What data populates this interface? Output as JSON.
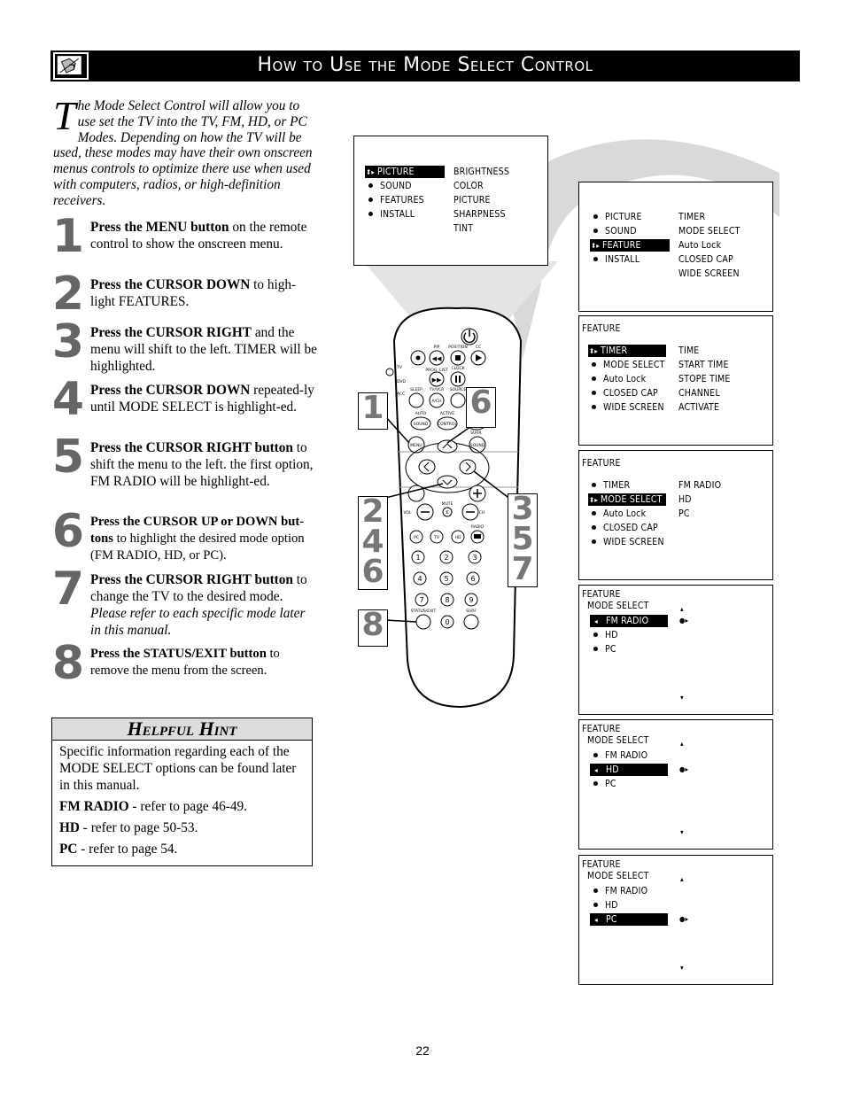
{
  "header": {
    "title": "How to Use the Mode Select Control",
    "icon": "remote-hand-icon"
  },
  "intro": {
    "dropcap": "T",
    "text": "he Mode Select Control will allow you to use set the TV into the TV, FM, HD, or PC Modes. Depending on how the TV will be used, these modes may have their own onscreen menus controls to optimize there use when used with computers, radios, or high-definition receivers."
  },
  "steps": [
    {
      "number": "1",
      "bold": "Press the MENU button",
      "text": " on the remote control to show the onscreen menu.",
      "italic": ""
    },
    {
      "number": "2",
      "bold": "Press the CURSOR DOWN",
      "text": " to high-light FEATURES.",
      "italic": ""
    },
    {
      "number": "3",
      "bold": "Press the CURSOR RIGHT",
      "text": " and the menu will shift to the left. TIMER will be highlighted.",
      "italic": ""
    },
    {
      "number": "4",
      "bold": "Press the CURSOR DOWN",
      "text": " repeated-ly until MODE SELECT is highlight-ed.",
      "italic": ""
    },
    {
      "number": "5",
      "bold": "Press the CURSOR RIGHT button",
      "text": " to shift the menu to the left. the first option, FM RADIO will be highlight-ed.",
      "italic": ""
    },
    {
      "number": "6",
      "bold": "Press the CURSOR UP or DOWN but-tons",
      "text": " to highlight the desired mode option (FM RADIO, HD, or PC).",
      "italic": ""
    },
    {
      "number": "7",
      "bold": "Press the CURSOR RIGHT button",
      "text": " to change the TV to the desired mode. ",
      "italic": "Please refer to each specific mode later in this manual."
    },
    {
      "number": "8",
      "bold": "Press the STATUS/EXIT button",
      "text": " to remove the menu from the screen.",
      "italic": ""
    }
  ],
  "hint": {
    "title": "Helpful Hint",
    "intro": "Specific information regarding each of the MODE SELECT options can be found later in this manual.",
    "refs": [
      {
        "bold": "FM RADIO",
        "text": " - refer to page 46-49."
      },
      {
        "bold": "HD",
        "text": " - refer to page 50-53."
      },
      {
        "bold": "PC",
        "text": " - refer to page 54."
      }
    ]
  },
  "screens": {
    "main": {
      "left": [
        {
          "label": "PICTURE",
          "highlighted": true
        },
        {
          "label": "SOUND",
          "highlighted": false
        },
        {
          "label": "FEATURES",
          "highlighted": false
        },
        {
          "label": "INSTALL",
          "highlighted": false
        }
      ],
      "right": [
        "BRIGHTNESS",
        "COLOR",
        "PICTURE",
        "SHARPNESS",
        "TINT"
      ]
    },
    "feature_main": {
      "left": [
        {
          "label": "PICTURE",
          "highlighted": false
        },
        {
          "label": "SOUND",
          "highlighted": false
        },
        {
          "label": "FEATURE",
          "highlighted": true
        },
        {
          "label": "INSTALL",
          "highlighted": false
        }
      ],
      "right": [
        "TIMER",
        "MODE SELECT",
        "Auto Lock",
        "CLOSED CAP",
        "WIDE SCREEN"
      ]
    },
    "feature_timer": {
      "title": "FEATURE",
      "left": [
        {
          "label": "TIMER",
          "highlighted": true
        },
        {
          "label": "MODE SELECT",
          "highlighted": false
        },
        {
          "label": "Auto Lock",
          "highlighted": false
        },
        {
          "label": "CLOSED CAP",
          "highlighted": false
        },
        {
          "label": "WIDE SCREEN",
          "highlighted": false
        }
      ],
      "right": [
        "TIME",
        "START TIME",
        "STOPE TIME",
        "CHANNEL",
        "ACTIVATE"
      ]
    },
    "feature_mode": {
      "title": "FEATURE",
      "left": [
        {
          "label": "TIMER",
          "highlighted": false
        },
        {
          "label": "MODE SELECT",
          "highlighted": true
        },
        {
          "label": "Auto Lock",
          "highlighted": false
        },
        {
          "label": "CLOSED CAP",
          "highlighted": false
        },
        {
          "label": "WIDE SCREEN",
          "highlighted": false
        }
      ],
      "right": [
        "FM RADIO",
        "HD",
        "PC"
      ]
    },
    "mode_fm": {
      "title": "FEATURE",
      "subtitle": "MODE SELECT",
      "options": [
        {
          "label": "FM RADIO",
          "highlighted": true
        },
        {
          "label": "HD",
          "highlighted": false
        },
        {
          "label": "PC",
          "highlighted": false
        }
      ]
    },
    "mode_hd": {
      "title": "FEATURE",
      "subtitle": "MODE SELECT",
      "options": [
        {
          "label": "FM RADIO",
          "highlighted": false
        },
        {
          "label": "HD",
          "highlighted": true
        },
        {
          "label": "PC",
          "highlighted": false
        }
      ]
    },
    "mode_pc": {
      "title": "FEATURE",
      "subtitle": "MODE SELECT",
      "options": [
        {
          "label": "FM RADIO",
          "highlighted": false
        },
        {
          "label": "HD",
          "highlighted": false
        },
        {
          "label": "PC",
          "highlighted": true
        }
      ]
    }
  },
  "remote": {
    "labels": {
      "pip": "PIP",
      "position": "POSITION",
      "cc": "CC",
      "prog_list": "PROG. LIST",
      "clock": "CLOCK",
      "tv": "TV",
      "dvd": "DVD",
      "acc": "ACC",
      "sleep": "SLEEP",
      "tv_vcr": "TV/VCR",
      "source": "SOURCE",
      "auto": "AUTO",
      "active": "ACTIVE",
      "ach": "A/CH",
      "sound": "SOUND",
      "control": "CONTROL",
      "surf_label": "SURF",
      "menu": "MENU",
      "surr": "SURR.",
      "surr_sound": "SOUND",
      "vol": "VOL",
      "mute": "MUTE",
      "ch": "CH",
      "radio": "RADIO",
      "pc": "PC",
      "tv_btn": "TV",
      "hd": "HD",
      "status_exit": "STATUS/EXIT",
      "surf": "SURF",
      "digits": [
        "1",
        "2",
        "3",
        "4",
        "5",
        "6",
        "7",
        "8",
        "9",
        "0"
      ]
    },
    "callouts": [
      "1",
      "6",
      "2\n4\n6",
      "3\n5\n7",
      "8"
    ]
  },
  "page_number": "22"
}
